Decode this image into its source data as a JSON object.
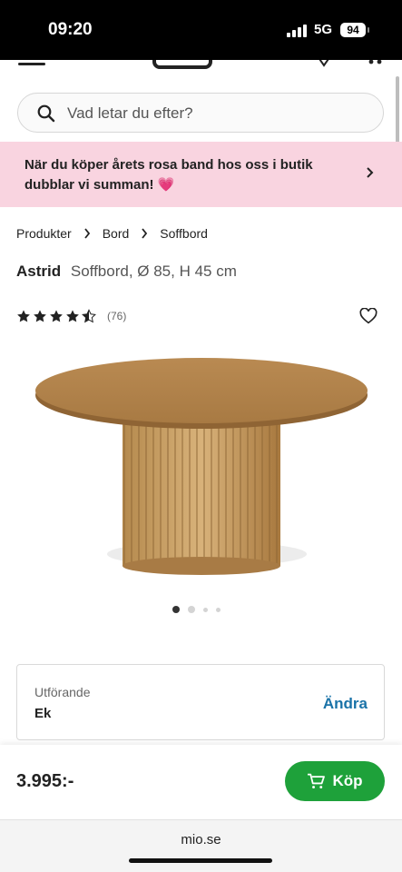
{
  "status_bar": {
    "time": "09:20",
    "network": "5G",
    "battery": "94"
  },
  "search": {
    "placeholder": "Vad letar du efter?"
  },
  "promo": {
    "text": "När du köper årets rosa band hos oss i butik dubblar vi summan! 💗"
  },
  "breadcrumb": [
    "Produkter",
    "Bord",
    "Soffbord"
  ],
  "product": {
    "name": "Astrid",
    "description": "Soffbord, Ø 85, H 45 cm",
    "rating_count": "(76)",
    "rating": 4.5,
    "price": "3.995:-"
  },
  "gallery": {
    "total_images": 4,
    "current_index": 1
  },
  "variant": {
    "label": "Utförande",
    "value": "Ek",
    "change_label": "Ändra"
  },
  "buy": {
    "label": "Köp"
  },
  "browser": {
    "url": "mio.se"
  },
  "colors": {
    "promo_bg": "#f9d4e0",
    "buy_green": "#1ea13a",
    "link_blue": "#1a73a8"
  }
}
